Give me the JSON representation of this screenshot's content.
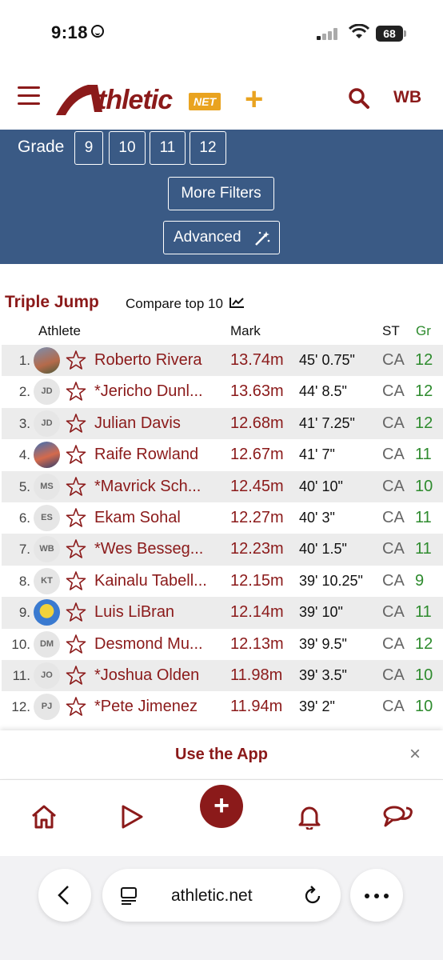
{
  "status": {
    "time": "9:18",
    "battery": "68"
  },
  "header": {
    "logo_main": "thletic",
    "logo_net": "NET",
    "user_initials": "WB"
  },
  "filters": {
    "grade_label": "Grade",
    "grades": [
      "9",
      "10",
      "11",
      "12"
    ],
    "more_filters": "More Filters",
    "advanced": "Advanced"
  },
  "section": {
    "title": "Triple Jump",
    "compare": "Compare top 10",
    "columns": {
      "athlete": "Athlete",
      "mark": "Mark",
      "st": "ST",
      "gr": "Gr"
    }
  },
  "rows": [
    {
      "rank": "1.",
      "initials": "",
      "avatar": "photo",
      "name": "Roberto Rivera",
      "mark": "13.74m",
      "feet": "45' 0.75\"",
      "st": "CA",
      "gr": "12"
    },
    {
      "rank": "2.",
      "initials": "JD",
      "avatar": "",
      "name": "*Jericho Dunl...",
      "mark": "13.63m",
      "feet": "44' 8.5\"",
      "st": "CA",
      "gr": "12"
    },
    {
      "rank": "3.",
      "initials": "JD",
      "avatar": "",
      "name": "Julian Davis",
      "mark": "12.68m",
      "feet": "41' 7.25\"",
      "st": "CA",
      "gr": "12"
    },
    {
      "rank": "4.",
      "initials": "",
      "avatar": "photo2",
      "name": "Raife Rowland",
      "mark": "12.67m",
      "feet": "41' 7\"",
      "st": "CA",
      "gr": "11"
    },
    {
      "rank": "5.",
      "initials": "MS",
      "avatar": "",
      "name": "*Mavrick Sch...",
      "mark": "12.45m",
      "feet": "40' 10\"",
      "st": "CA",
      "gr": "10"
    },
    {
      "rank": "6.",
      "initials": "ES",
      "avatar": "",
      "name": "Ekam Sohal",
      "mark": "12.27m",
      "feet": "40' 3\"",
      "st": "CA",
      "gr": "11"
    },
    {
      "rank": "7.",
      "initials": "WB",
      "avatar": "",
      "name": "*Wes Besseg...",
      "mark": "12.23m",
      "feet": "40' 1.5\"",
      "st": "CA",
      "gr": "11"
    },
    {
      "rank": "8.",
      "initials": "KT",
      "avatar": "",
      "name": "Kainalu Tabell...",
      "mark": "12.15m",
      "feet": "39' 10.25\"",
      "st": "CA",
      "gr": "9"
    },
    {
      "rank": "9.",
      "initials": "",
      "avatar": "photo3",
      "name": "Luis LiBran",
      "mark": "12.14m",
      "feet": "39' 10\"",
      "st": "CA",
      "gr": "11"
    },
    {
      "rank": "10.",
      "initials": "DM",
      "avatar": "",
      "name": "Desmond Mu...",
      "mark": "12.13m",
      "feet": "39' 9.5\"",
      "st": "CA",
      "gr": "12"
    },
    {
      "rank": "11.",
      "initials": "JO",
      "avatar": "",
      "name": "*Joshua Olden",
      "mark": "11.98m",
      "feet": "39' 3.5\"",
      "st": "CA",
      "gr": "10"
    },
    {
      "rank": "12.",
      "initials": "PJ",
      "avatar": "",
      "name": "*Pete Jimenez",
      "mark": "11.94m",
      "feet": "39' 2\"",
      "st": "CA",
      "gr": "10"
    }
  ],
  "banner": {
    "text": "Use the App",
    "close": "×"
  },
  "bottomnav": {
    "add": "+"
  },
  "browser": {
    "url": "athletic.net"
  },
  "colors": {
    "brand": "#8b1a1a",
    "panel": "#3a5a85",
    "grade_green": "#2e8b2e",
    "accent": "#e9a320"
  }
}
